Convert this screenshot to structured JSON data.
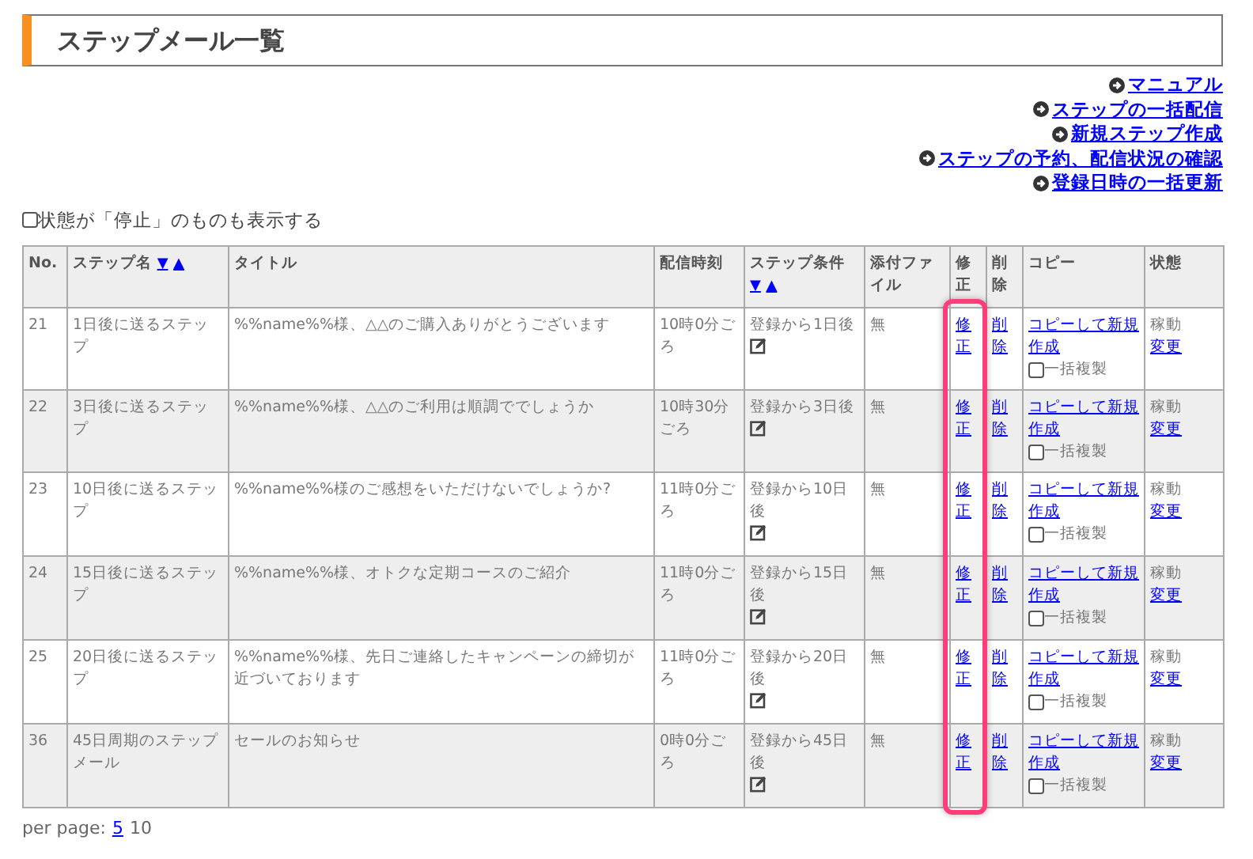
{
  "page_title": "ステップメール一覧",
  "links": [
    {
      "label": "マニュアル"
    },
    {
      "label": "ステップの一括配信"
    },
    {
      "label": "新規ステップ作成"
    },
    {
      "label": "ステップの予約、配信状況の確認"
    },
    {
      "label": "登録日時の一括更新"
    }
  ],
  "show_stopped": {
    "label": "状態が「停止」のものも表示する",
    "checked": false
  },
  "table": {
    "columns": [
      {
        "label": "No.",
        "highlighted": false
      },
      {
        "label": "ステップ名",
        "sort_desc": "▼",
        "sort_asc": "▲",
        "highlighted": false
      },
      {
        "label": "タイトル",
        "highlighted": false
      },
      {
        "label": "配信時刻",
        "highlighted": false
      },
      {
        "label": "ステップ条件",
        "sort_desc": "▼",
        "sort_asc": "▲",
        "highlighted": false
      },
      {
        "label": "添付ファイル",
        "highlighted": false
      },
      {
        "label": "修正",
        "highlighted": true
      },
      {
        "label": "削除",
        "highlighted": false
      },
      {
        "label": "コピー",
        "highlighted": false
      },
      {
        "label": "状態",
        "highlighted": false
      }
    ],
    "rows": [
      {
        "no": "21",
        "name": "1日後に送るステップ",
        "title": "%%name%%様、△△のご購入ありがとうございます",
        "time": "10時0分ごろ",
        "condition": "登録から1日後",
        "attachment": "無",
        "edit": "修正",
        "delete": "削除",
        "copy": "コピーして新規作成",
        "bulk_copy": {
          "label": "一括複製",
          "checked": false
        },
        "status": "稼動",
        "status_change": "変更"
      },
      {
        "no": "22",
        "name": "3日後に送るステップ",
        "title": "%%name%%様、△△のご利用は順調ででしょうか",
        "time": "10時30分ごろ",
        "condition": "登録から3日後",
        "attachment": "無",
        "edit": "修正",
        "delete": "削除",
        "copy": "コピーして新規作成",
        "bulk_copy": {
          "label": "一括複製",
          "checked": false
        },
        "status": "稼動",
        "status_change": "変更"
      },
      {
        "no": "23",
        "name": "10日後に送るステップ",
        "title": "%%name%%様のご感想をいただけないでしょうか?",
        "time": "11時0分ごろ",
        "condition": "登録から10日後",
        "attachment": "無",
        "edit": "修正",
        "delete": "削除",
        "copy": "コピーして新規作成",
        "bulk_copy": {
          "label": "一括複製",
          "checked": false
        },
        "status": "稼動",
        "status_change": "変更"
      },
      {
        "no": "24",
        "name": "15日後に送るステップ",
        "title": "%%name%%様、オトクな定期コースのご紹介",
        "time": "11時0分ごろ",
        "condition": "登録から15日後",
        "attachment": "無",
        "edit": "修正",
        "delete": "削除",
        "copy": "コピーして新規作成",
        "bulk_copy": {
          "label": "一括複製",
          "checked": false
        },
        "status": "稼動",
        "status_change": "変更"
      },
      {
        "no": "25",
        "name": "20日後に送るステップ",
        "title": "%%name%%様、先日ご連絡したキャンペーンの締切が近づいております",
        "time": "11時0分ごろ",
        "condition": "登録から20日後",
        "attachment": "無",
        "edit": "修正",
        "delete": "削除",
        "copy": "コピーして新規作成",
        "bulk_copy": {
          "label": "一括複製",
          "checked": false
        },
        "status": "稼動",
        "status_change": "変更"
      },
      {
        "no": "36",
        "name": "45日周期のステップメール",
        "title": "セールのお知らせ",
        "time": "0時0分ごろ",
        "condition": "登録から45日後",
        "attachment": "無",
        "edit": "修正",
        "delete": "削除",
        "copy": "コピーして新規作成",
        "bulk_copy": {
          "label": "一括複製",
          "checked": false
        },
        "status": "稼動",
        "status_change": "変更"
      }
    ]
  },
  "pagination": {
    "label": "per page:",
    "options": [
      {
        "label": "5",
        "selected": false
      },
      {
        "label": "10",
        "selected": true
      }
    ]
  }
}
